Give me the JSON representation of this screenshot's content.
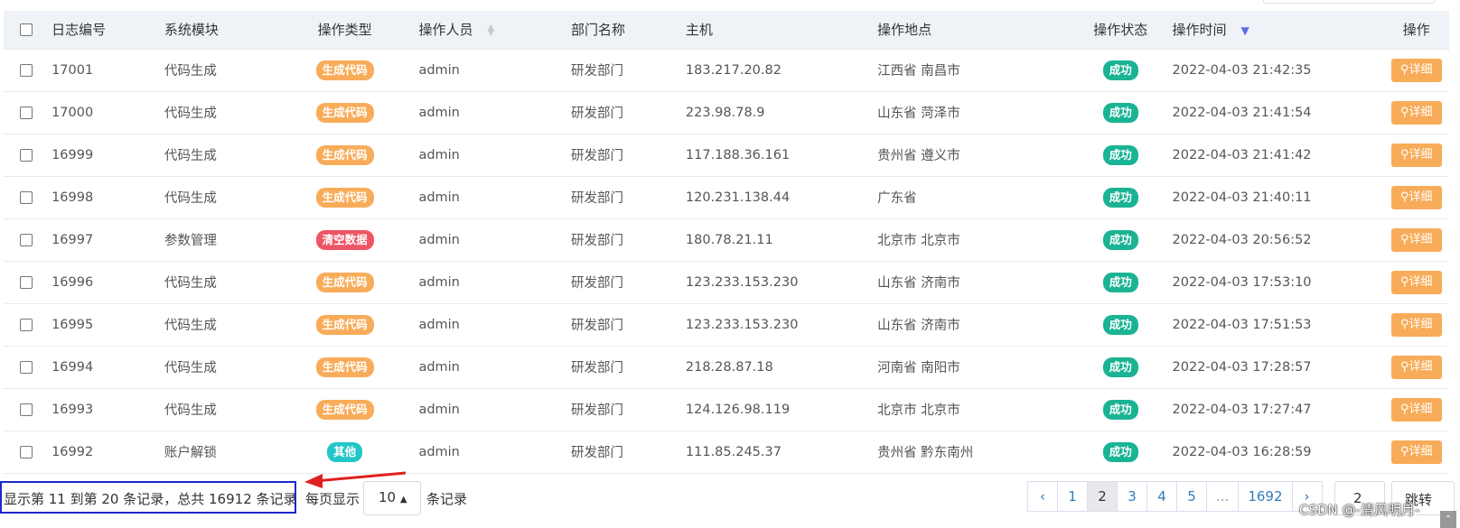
{
  "table": {
    "columns": [
      "日志编号",
      "系统模块",
      "操作类型",
      "操作人员",
      "部门名称",
      "主机",
      "操作地点",
      "操作状态",
      "操作时间",
      "操作"
    ],
    "rows": [
      {
        "id": "17001",
        "module": "代码生成",
        "type": "生成代码",
        "type_color": "#f8ac59",
        "user": "admin",
        "dept": "研发部门",
        "host": "183.217.20.82",
        "location": "江西省 南昌市",
        "status": "成功",
        "time": "2022-04-03 21:42:35",
        "action": "详细"
      },
      {
        "id": "17000",
        "module": "代码生成",
        "type": "生成代码",
        "type_color": "#f8ac59",
        "user": "admin",
        "dept": "研发部门",
        "host": "223.98.78.9",
        "location": "山东省 菏泽市",
        "status": "成功",
        "time": "2022-04-03 21:41:54",
        "action": "详细"
      },
      {
        "id": "16999",
        "module": "代码生成",
        "type": "生成代码",
        "type_color": "#f8ac59",
        "user": "admin",
        "dept": "研发部门",
        "host": "117.188.36.161",
        "location": "贵州省 遵义市",
        "status": "成功",
        "time": "2022-04-03 21:41:42",
        "action": "详细"
      },
      {
        "id": "16998",
        "module": "代码生成",
        "type": "生成代码",
        "type_color": "#f8ac59",
        "user": "admin",
        "dept": "研发部门",
        "host": "120.231.138.44",
        "location": "广东省",
        "status": "成功",
        "time": "2022-04-03 21:40:11",
        "action": "详细"
      },
      {
        "id": "16997",
        "module": "参数管理",
        "type": "清空数据",
        "type_color": "#ed5565",
        "user": "admin",
        "dept": "研发部门",
        "host": "180.78.21.11",
        "location": "北京市 北京市",
        "status": "成功",
        "time": "2022-04-03 20:56:52",
        "action": "详细"
      },
      {
        "id": "16996",
        "module": "代码生成",
        "type": "生成代码",
        "type_color": "#f8ac59",
        "user": "admin",
        "dept": "研发部门",
        "host": "123.233.153.230",
        "location": "山东省 济南市",
        "status": "成功",
        "time": "2022-04-03 17:53:10",
        "action": "详细"
      },
      {
        "id": "16995",
        "module": "代码生成",
        "type": "生成代码",
        "type_color": "#f8ac59",
        "user": "admin",
        "dept": "研发部门",
        "host": "123.233.153.230",
        "location": "山东省 济南市",
        "status": "成功",
        "time": "2022-04-03 17:51:53",
        "action": "详细"
      },
      {
        "id": "16994",
        "module": "代码生成",
        "type": "生成代码",
        "type_color": "#f8ac59",
        "user": "admin",
        "dept": "研发部门",
        "host": "218.28.87.18",
        "location": "河南省 南阳市",
        "status": "成功",
        "time": "2022-04-03 17:28:57",
        "action": "详细"
      },
      {
        "id": "16993",
        "module": "代码生成",
        "type": "生成代码",
        "type_color": "#f8ac59",
        "user": "admin",
        "dept": "研发部门",
        "host": "124.126.98.119",
        "location": "北京市 北京市",
        "status": "成功",
        "time": "2022-04-03 17:27:47",
        "action": "详细"
      },
      {
        "id": "16992",
        "module": "账户解锁",
        "type": "其他",
        "type_color": "#23c6c8",
        "user": "admin",
        "dept": "研发部门",
        "host": "111.85.245.37",
        "location": "贵州省 黔东南州",
        "status": "成功",
        "time": "2022-04-03 16:28:59",
        "action": "详细"
      }
    ]
  },
  "colors": {
    "status_success": "#1ab394",
    "detail_button": "#f8ac59",
    "header_bg": "#eff3f8",
    "highlight_box": "#1a28cc",
    "arrow": "#e02020"
  },
  "footer": {
    "info": "显示第 11 到第 20 条记录，总共 16912 条记录",
    "per_page_label": "每页显示",
    "page_size": "10",
    "records_label": "条记录",
    "pages": [
      "‹",
      "1",
      "2",
      "3",
      "4",
      "5",
      "...",
      "1692",
      "›"
    ],
    "active_page": "2",
    "goto_value": "2",
    "goto_label": "跳转"
  },
  "watermark": "CSDN @-清风明月-"
}
